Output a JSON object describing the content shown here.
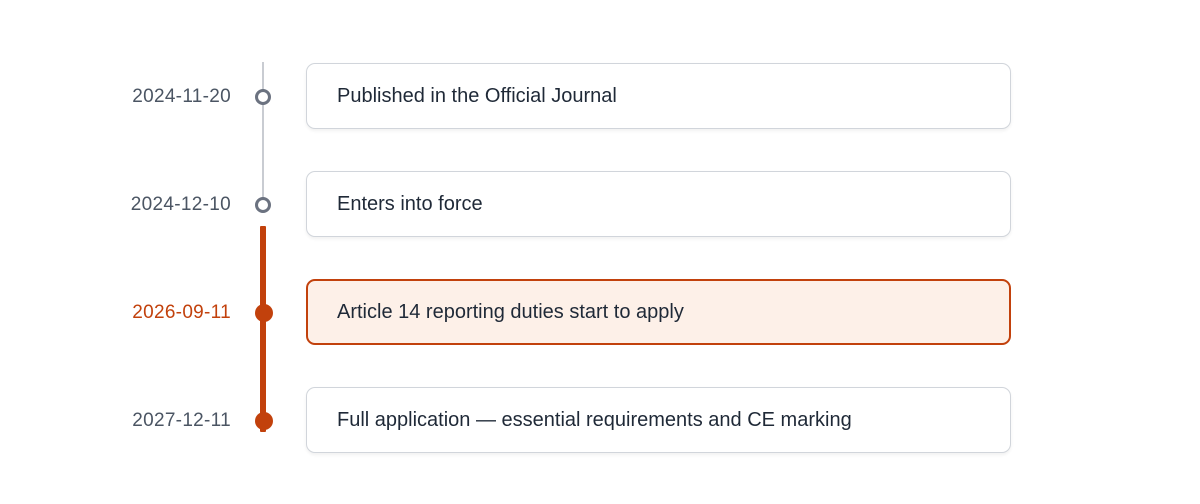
{
  "timeline": {
    "events": [
      {
        "date": "2024-11-20",
        "label": "Published in the Official Journal",
        "state": "past"
      },
      {
        "date": "2024-12-10",
        "label": "Enters into force",
        "state": "past"
      },
      {
        "date": "2026-09-11",
        "label": "Article 14 reporting duties start to apply",
        "state": "current"
      },
      {
        "date": "2027-12-11",
        "label": "Full application — essential requirements and CE marking",
        "state": "upcoming"
      }
    ],
    "colors": {
      "accent": "#c2410c",
      "accent_background": "#fdf0e8",
      "past_marker": "#6b7280",
      "past_track": "#c9ccd2",
      "card_border": "#d1d5db"
    }
  }
}
